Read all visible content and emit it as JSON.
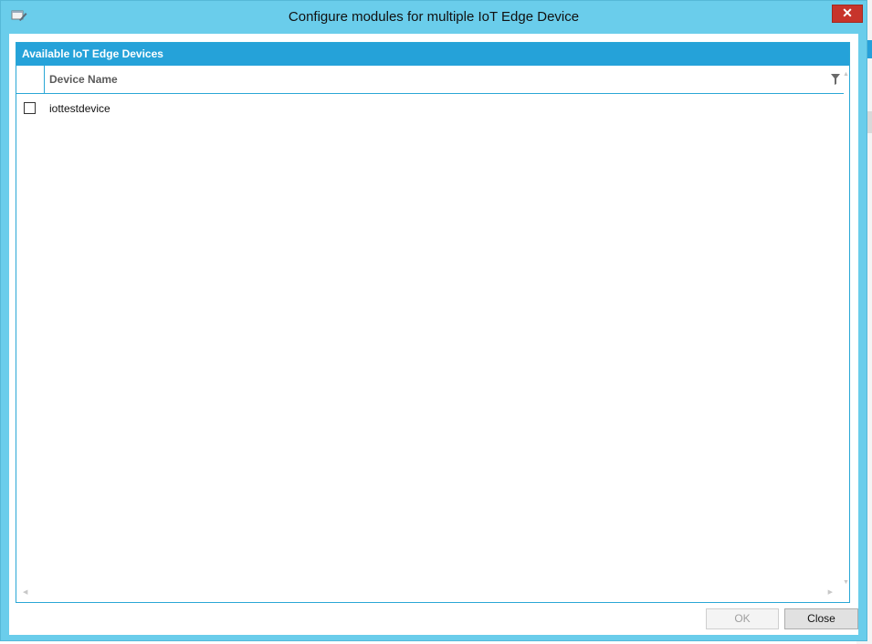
{
  "window": {
    "title": "Configure modules for multiple IoT Edge Device",
    "close_glyph": "✕",
    "icon": "edit-window-icon"
  },
  "grid": {
    "header": "Available IoT Edge Devices",
    "columns": [
      "Device Name"
    ],
    "rows": [
      {
        "checked": false,
        "device_name": "iottestdevice"
      }
    ]
  },
  "buttons": {
    "ok_label": "OK",
    "ok_enabled": false,
    "close_label": "Close"
  },
  "colors": {
    "title_bar": "#6acdeb",
    "grid_header": "#25a2d9",
    "close_button": "#c7342b"
  }
}
